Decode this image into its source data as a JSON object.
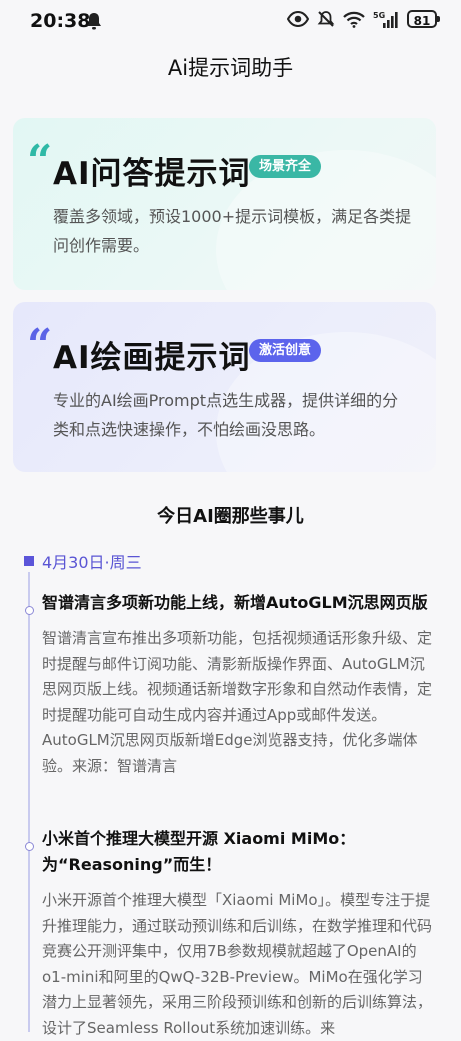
{
  "status_bar": {
    "time": "20:38",
    "battery": "81",
    "network": "5G",
    "icons": [
      "notification-bell-icon",
      "eye-icon",
      "mute-icon",
      "wifi-icon",
      "signal-icon",
      "battery-icon"
    ]
  },
  "header": {
    "title": "Ai提示词助手"
  },
  "cards": [
    {
      "quote": "“",
      "title": "AI问答提示词",
      "badge": "场景齐全",
      "description": "覆盖多领域，预设1000+提示词模板，满足各类提问创作需要。",
      "accent": "#3ab7a5"
    },
    {
      "quote": "“",
      "title": "AI绘画提示词",
      "badge": "激活创意",
      "description": "专业的AI绘画Prompt点选生成器，提供详细的分类和点选快速操作，不怕绘画没思路。",
      "accent": "#5c64ec"
    }
  ],
  "news": {
    "section_title": "今日AI圈那些事儿",
    "date": "4月30日·周三",
    "items": [
      {
        "title": "智谱清言多项新功能上线，新增AutoGLM沉思网页版",
        "body": "智谱清言宣布推出多项新功能，包括视频通话形象升级、定时提醒与邮件订阅功能、清影新版操作界面、AutoGLM沉思网页版上线。视频通话新增数字形象和自然动作表情，定时提醒功能可自动生成内容并通过App或邮件发送。AutoGLM沉思网页版新增Edge浏览器支持，优化多端体验。来源：智谱清言"
      },
      {
        "title": "小米首个推理大模型开源 Xiaomi MiMo：为“Reasoning”而生！",
        "body": "小米开源首个推理大模型「Xiaomi MiMo」。模型专注于提升推理能力，通过联动预训练和后训练，在数学推理和代码竞赛公开测评集中，仅用7B参数规模就超越了OpenAI的o1-mini和阿里的QwQ-32B-Preview。MiMo在强化学习潜力上显著领先，采用三阶段预训练和创新的后训练算法，设计了Seamless Rollout系统加速训练。来"
      }
    ]
  }
}
